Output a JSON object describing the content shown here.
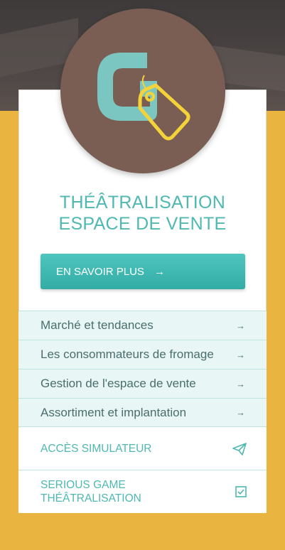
{
  "hero": {
    "logo_alt_icon": "tag-icon"
  },
  "title": {
    "line1": "THÉÂTRALISATION",
    "line2": "ESPACE DE VENTE"
  },
  "cta": {
    "label": "EN SAVOIR PLUS",
    "arrow": "→"
  },
  "menu": {
    "items": [
      {
        "label": "Marché et tendances",
        "icon": "→"
      },
      {
        "label": "Les consommateurs de fromage",
        "icon": "→"
      },
      {
        "label": "Gestion de l'espace de vente",
        "icon": "→"
      },
      {
        "label": "Assortiment et implantation",
        "icon": "→"
      }
    ]
  },
  "actions": {
    "simulator": {
      "label": "ACCÈS SIMULATEUR",
      "icon": "paper-plane-icon"
    },
    "game": {
      "line1": "SERIOUS GAME",
      "line2": "THÉÂTRALISATION",
      "icon": "checkbox-icon"
    }
  },
  "colors": {
    "accent": "#4FB8B2",
    "background": "#E9B43F",
    "logo_circle": "#7A5E53",
    "tag": "#F4D33A"
  }
}
